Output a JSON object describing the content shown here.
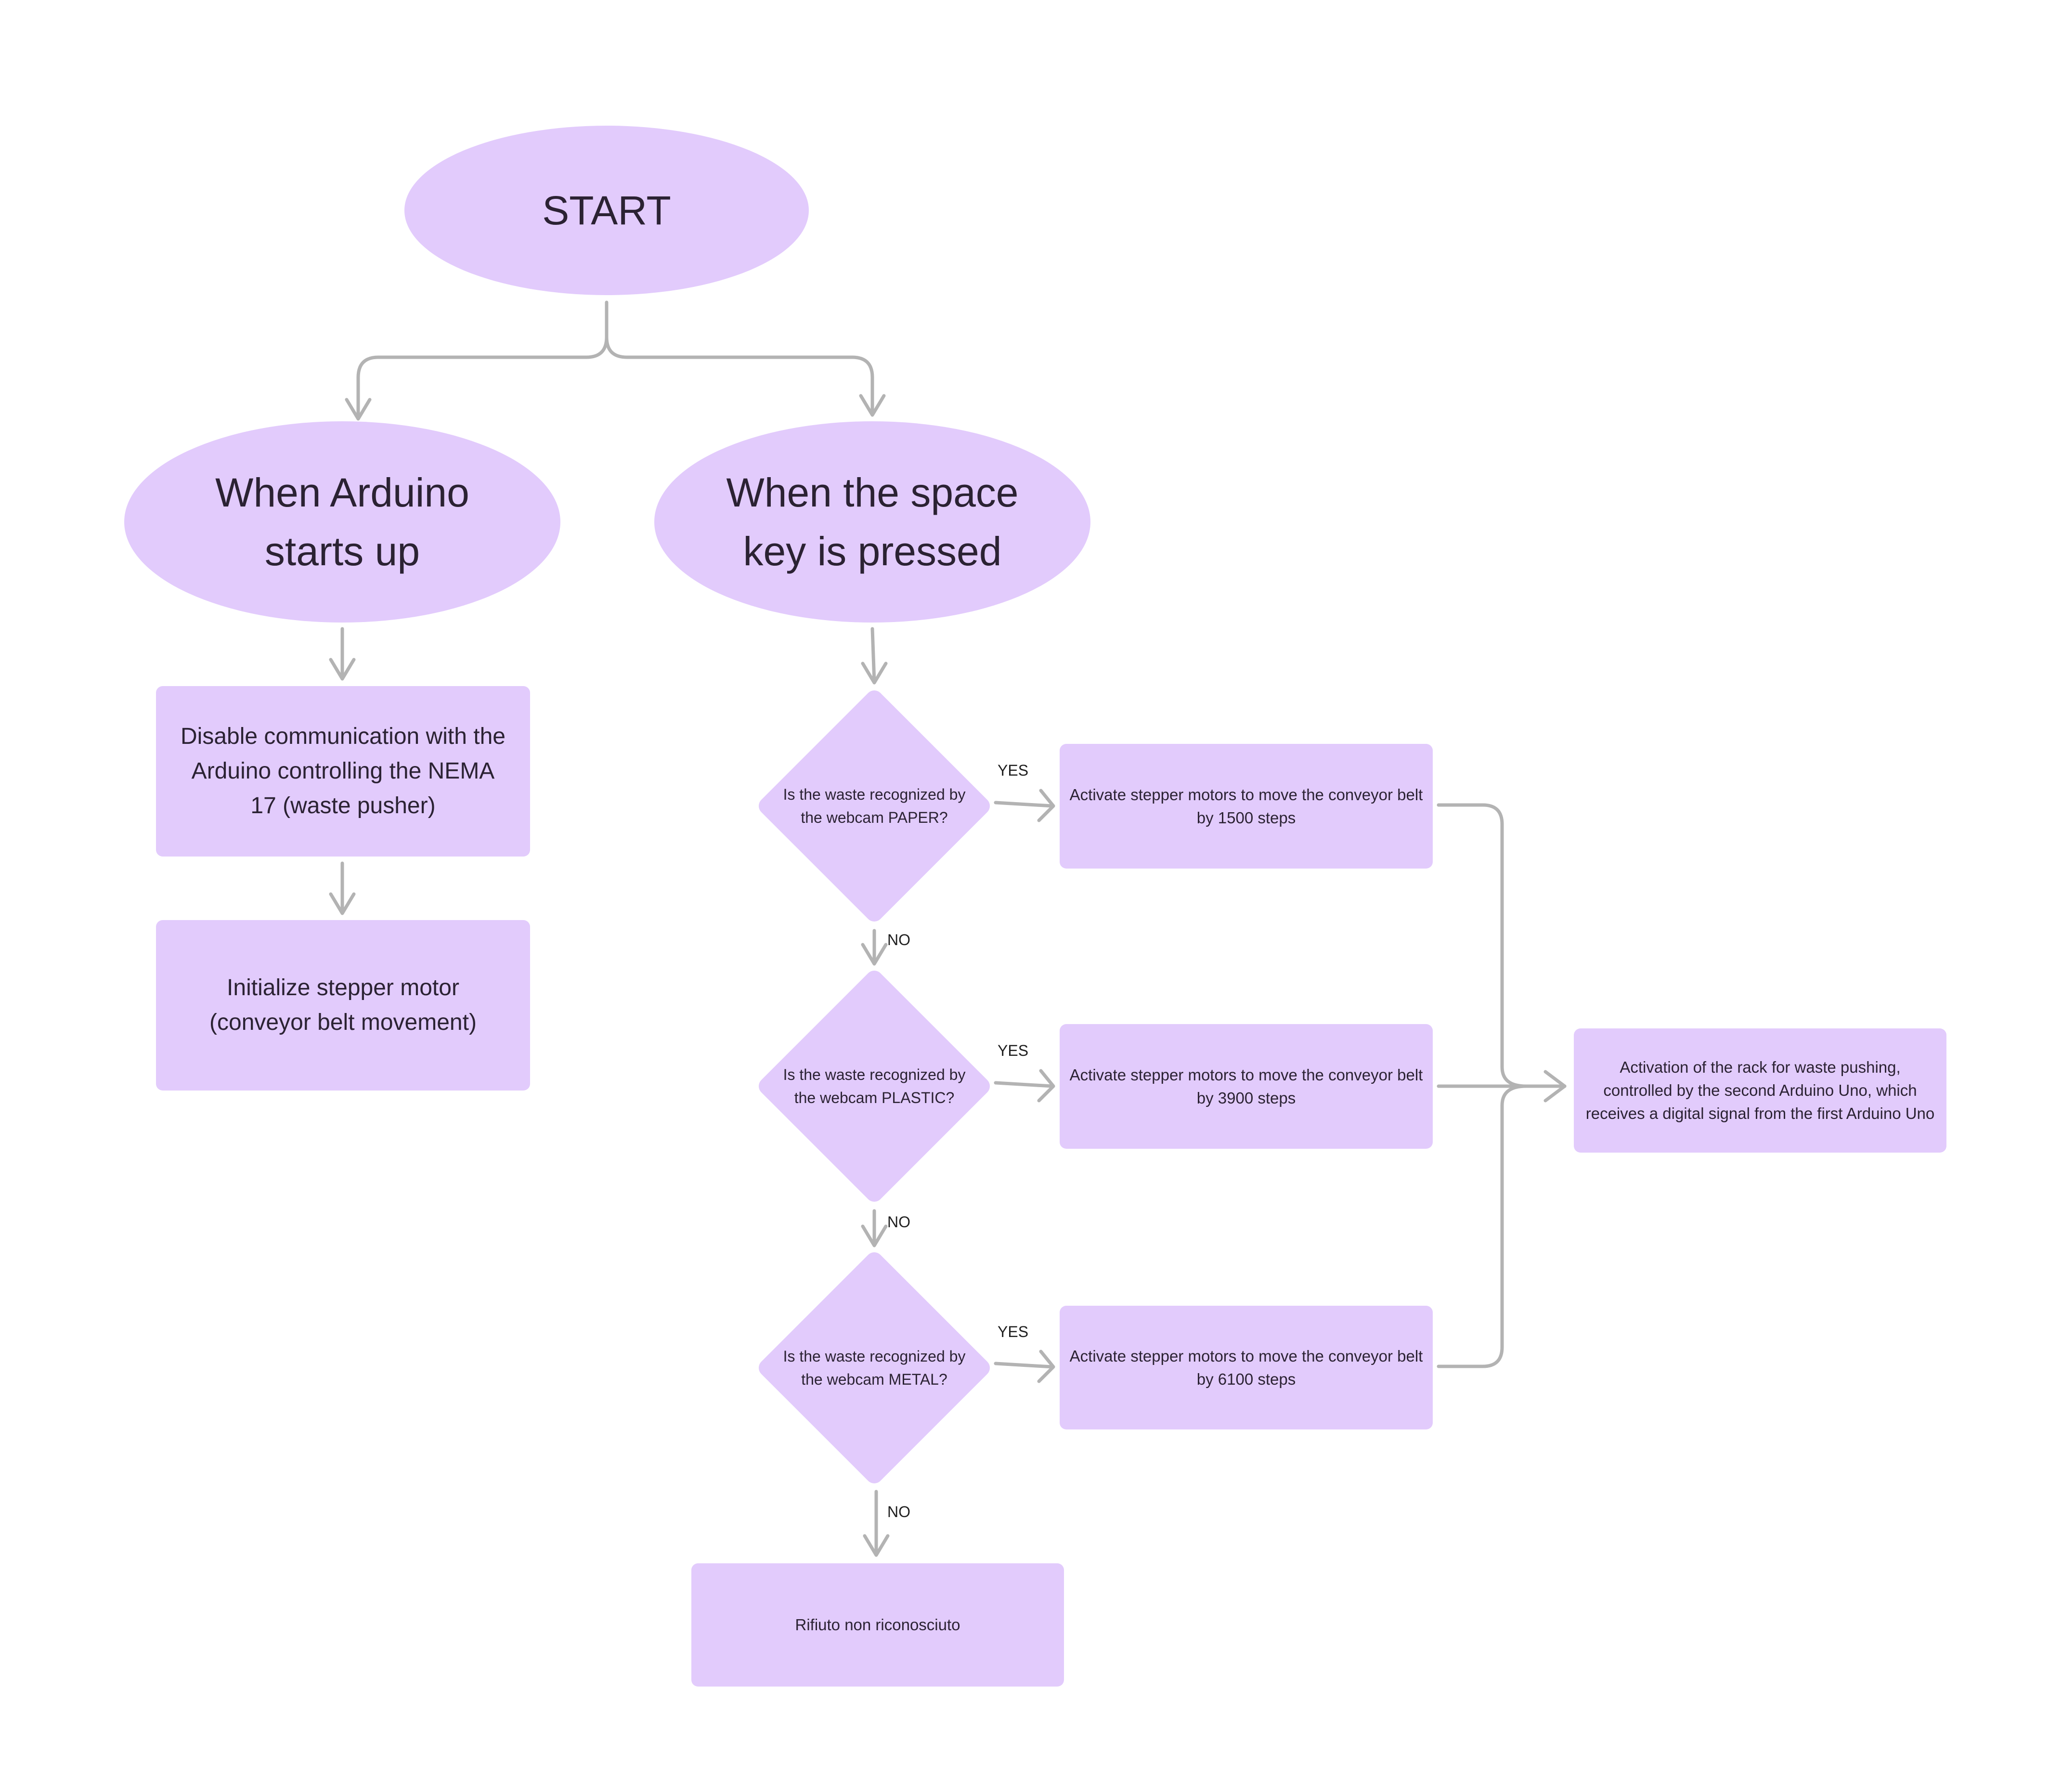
{
  "diagram": {
    "type": "flowchart",
    "colors": {
      "node_fill": "#e2cbfc",
      "connector": "#b3b3b3",
      "text": "#2b2233"
    },
    "nodes": {
      "start": "START",
      "arduino_startup": "When Arduino starts up",
      "space_pressed": "When the space key is pressed",
      "disable_comm": "Disable communication with the Arduino controlling the NEMA 17 (waste pusher)",
      "init_stepper": "Initialize stepper motor (conveyor belt movement)",
      "decision_paper": "Is the waste recognized by the webcam PAPER?",
      "decision_plastic": "Is the waste recognized by the webcam PLASTIC?",
      "decision_metal": "Is the waste recognized by the webcam METAL?",
      "action_paper": "Activate stepper motors to move the conveyor belt by 1500 steps",
      "action_plastic": "Activate stepper motors to move the conveyor belt by 3900 steps",
      "action_metal": "Activate stepper motors to move the conveyor belt by 6100 steps",
      "rack_activation": "Activation of the rack for waste pushing, controlled by the second Arduino Uno, which receives a digital signal from the first Arduino Uno",
      "unrecognized": "Rifiuto non riconosciuto"
    },
    "edge_labels": {
      "yes_paper": "YES",
      "no_paper": "NO",
      "yes_plastic": "YES",
      "no_plastic": "NO",
      "yes_metal": "YES",
      "no_metal": "NO"
    },
    "edges": [
      {
        "from": "start",
        "to": "arduino_startup"
      },
      {
        "from": "start",
        "to": "space_pressed"
      },
      {
        "from": "arduino_startup",
        "to": "disable_comm"
      },
      {
        "from": "disable_comm",
        "to": "init_stepper"
      },
      {
        "from": "space_pressed",
        "to": "decision_paper"
      },
      {
        "from": "decision_paper",
        "to": "action_paper",
        "label": "YES"
      },
      {
        "from": "decision_paper",
        "to": "decision_plastic",
        "label": "NO"
      },
      {
        "from": "decision_plastic",
        "to": "action_plastic",
        "label": "YES"
      },
      {
        "from": "decision_plastic",
        "to": "decision_metal",
        "label": "NO"
      },
      {
        "from": "decision_metal",
        "to": "action_metal",
        "label": "YES"
      },
      {
        "from": "decision_metal",
        "to": "unrecognized",
        "label": "NO"
      },
      {
        "from": "action_paper",
        "to": "rack_activation"
      },
      {
        "from": "action_plastic",
        "to": "rack_activation"
      },
      {
        "from": "action_metal",
        "to": "rack_activation"
      }
    ]
  }
}
